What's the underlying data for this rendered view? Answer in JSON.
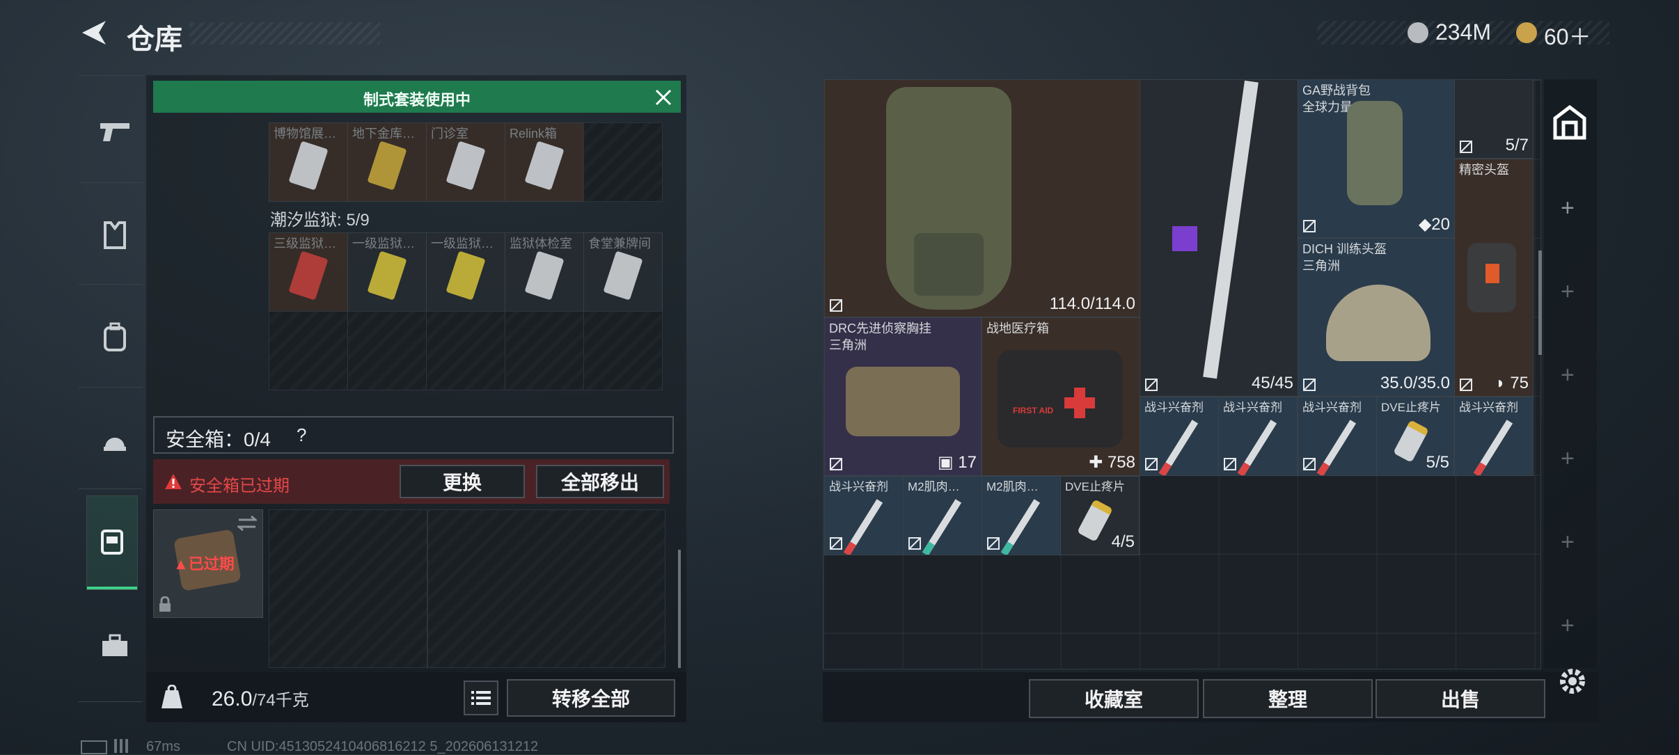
{
  "header": {
    "title": "仓库",
    "currency1": "234M",
    "currency2": "60＋"
  },
  "left": {
    "banner": "制式套装使用中",
    "row1_labels": [
      "博物馆展…",
      "地下金库…",
      "门诊室",
      "Relink箱"
    ],
    "section_label": "潮汐监狱: 5/9",
    "row2_labels": [
      "三级监狱…",
      "一级监狱…",
      "一级监狱…",
      "监狱体检室",
      "食堂兼牌间"
    ],
    "safebox_label": "安全箱：0/4",
    "safebox_help": "?",
    "expired_warning": "安全箱已过期",
    "replace_btn": "更换",
    "remove_all_btn": "全部移出",
    "expired_badge": "已过期",
    "weight_value": "26.0",
    "weight_max": "/74千克",
    "transfer_all_btn": "转移全部"
  },
  "items": {
    "armor": {
      "count": "114.0/114.0"
    },
    "rifle": {
      "count": "45/45"
    },
    "backpack": {
      "name": "GA野战背包",
      "sub": "全球力量",
      "count": "20"
    },
    "topright": {
      "count": "5/7"
    },
    "precise_helmet": {
      "name": "精密头盔",
      "count": "75"
    },
    "dich_helmet": {
      "name": "DICH 训练头盔",
      "sub": "三角洲",
      "count": "35.0/35.0"
    },
    "chestrig": {
      "name": "DRC先进侦察胸挂",
      "sub": "三角洲",
      "count": "17"
    },
    "medkit": {
      "name": "战地医疗箱",
      "count": "758",
      "print": "FIRST AID"
    },
    "stim_row1": [
      "战斗兴奋剂",
      "战斗兴奋剂",
      "战斗兴奋剂"
    ],
    "dve1": {
      "name": "DVE止疼片",
      "count": "5/5"
    },
    "stim_row1b": "战斗兴奋剂",
    "row3": [
      "战斗兴奋剂",
      "M2肌肉…",
      "M2肌肉…"
    ],
    "dve2": {
      "name": "DVE止疼片",
      "count": "4/5"
    }
  },
  "right_buttons": {
    "collection": "收藏室",
    "sort": "整理",
    "sell": "出售"
  },
  "status": {
    "ping": "67ms",
    "uid": "CN UID:4513052410406816212 5_202606131212"
  },
  "colors": {
    "green_banner": "#1f7a4e",
    "red_warning": "#e03a3a",
    "accent_green": "#3fd08a"
  }
}
